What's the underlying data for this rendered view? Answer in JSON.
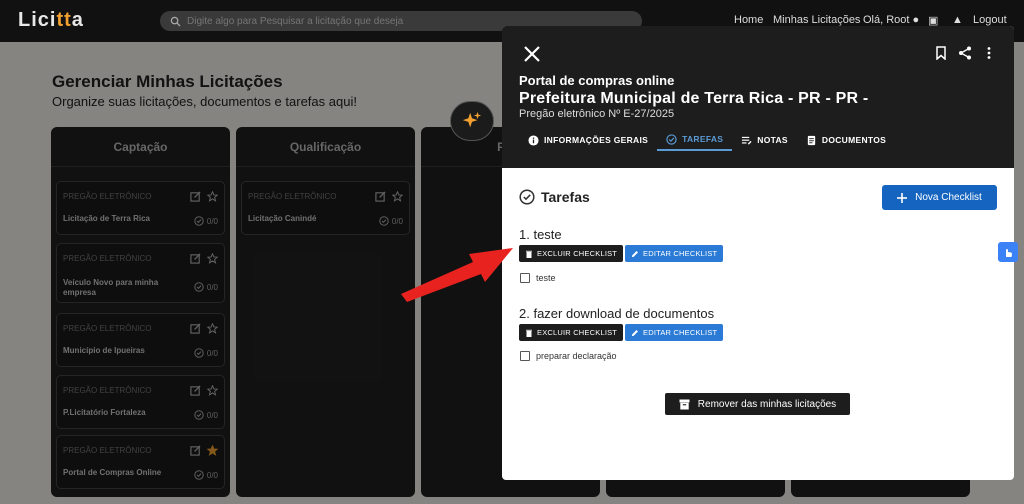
{
  "app": {
    "logo_main": "Lici",
    "logo_accent": "tt",
    "logo_end": "a",
    "search_placeholder": "Digite algo para Pesquisar a licitação que deseja"
  },
  "nav": {
    "home": "Home",
    "minhas": "Minhas Licitações",
    "user": "Olá, Root",
    "logout": "Logout"
  },
  "page": {
    "title": "Gerenciar Minhas Licitações",
    "subtitle": "Organize suas licitações, documentos e tarefas aqui!",
    "columns": [
      "Captação",
      "Qualificação",
      "Prep"
    ],
    "captacao_cards": [
      {
        "type": "PREGÃO ELETRÔNICO",
        "name": "Licitação de Terra Rica",
        "count": "0/0",
        "starred": false
      },
      {
        "type": "PREGÃO ELETRÔNICO",
        "name": "Veículo Novo para minha empresa",
        "count": "0/0",
        "starred": false
      },
      {
        "type": "PREGÃO ELETRÔNICO",
        "name": "Município de Ipueiras",
        "count": "0/0",
        "starred": false
      },
      {
        "type": "PREGÃO ELETRÔNICO",
        "name": "P.Licitatório Fortaleza",
        "count": "0/0",
        "starred": false
      },
      {
        "type": "PREGÃO ELETRÔNICO",
        "name": "Portal de Compras Online",
        "count": "0/0",
        "starred": true
      }
    ],
    "qualificacao_cards": [
      {
        "type": "PREGÃO ELETRÔNICO",
        "name": "Licitação Canindé",
        "count": "0/0",
        "starred": false
      }
    ]
  },
  "modal": {
    "portal": "Portal de compras online",
    "prefeitura": "Prefeitura Municipal de Terra Rica - PR - PR -",
    "pregao": "Pregão eletrônico Nº E-27/2025",
    "tabs": [
      "INFORMAÇÕES GERAIS",
      "TAREFAS",
      "NOTAS",
      "DOCUMENTOS"
    ],
    "active_tab": "TAREFAS",
    "section_title": "Tarefas",
    "nova_checklist": "Nova Checklist",
    "checklists": [
      {
        "title": "1. teste",
        "delete_label": "EXCLUIR CHECKLIST",
        "edit_label": "EDITAR CHECKLIST",
        "tasks": [
          "teste"
        ]
      },
      {
        "title": "2. fazer download de documentos",
        "delete_label": "EXCLUIR CHECKLIST",
        "edit_label": "EDITAR CHECKLIST",
        "tasks": [
          "preparar declaração"
        ]
      }
    ],
    "remove_label": "Remover das minhas licitações"
  },
  "colors": {
    "accent": "#1565c0",
    "star": "#f0a030",
    "arrow": "#e8231f"
  }
}
